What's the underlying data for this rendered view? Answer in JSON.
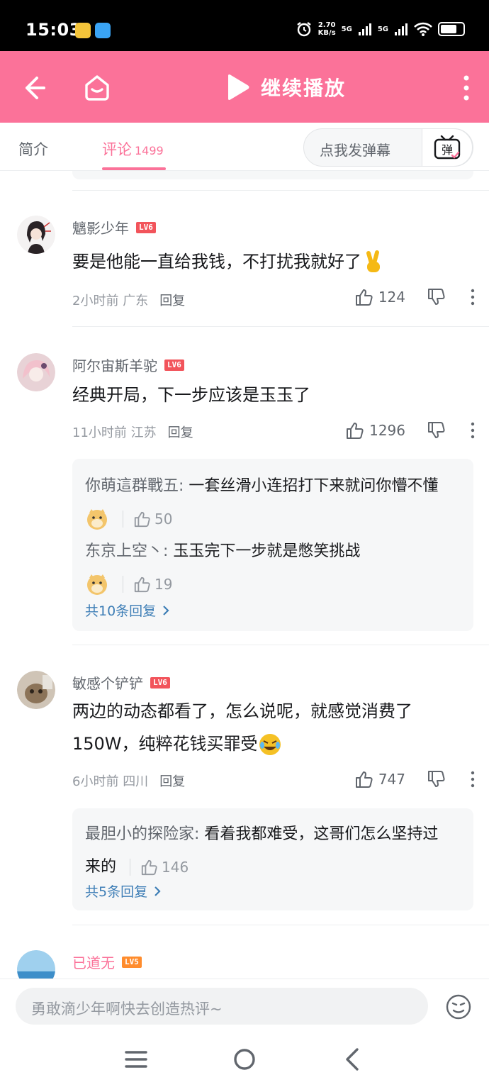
{
  "status_bar": {
    "time": "15:03",
    "speed_value": "2.70",
    "speed_unit": "KB/s",
    "net1": "5G",
    "net2": "5G"
  },
  "header": {
    "play_label": "继续播放",
    "icons": [
      "back-arrow-icon",
      "home-icon",
      "play-icon",
      "more-vertical-icon"
    ]
  },
  "tabs": {
    "intro": "简介",
    "comments": "评论",
    "comment_count": "1499",
    "danmaku_placeholder": "点我发弹幕",
    "danmaku_button": "弹"
  },
  "comments": [
    {
      "username": "魑影少年",
      "level": "LV6",
      "text": "要是他能一直给我钱，不打扰我就好了",
      "emoji": "victory-hand-emoji",
      "time": "2小时前",
      "location": "广东",
      "reply_label": "回复",
      "likes": "124"
    },
    {
      "username": "阿尔宙斯羊驼",
      "level": "LV6",
      "text": "经典开局，下一步应该是玉玉了",
      "time": "11小时前",
      "location": "江苏",
      "reply_label": "回复",
      "likes": "1296",
      "replies": [
        {
          "name": "你萌這群戰五:",
          "text": " 一套丝滑小连招打下来就问你懵不懂",
          "emoji": "doge-emoji",
          "likes": "50"
        },
        {
          "name": "东京上空丶:",
          "text": " 玉玉完下一步就是憋笑挑战",
          "emoji": "doge-emoji",
          "likes": "19"
        }
      ],
      "more_replies": "共10条回复"
    },
    {
      "username": "敏感个铲铲",
      "level": "LV6",
      "text": "两边的动态都看了，怎么说呢，就感觉消费了150W，纯粹花钱买罪受",
      "emoji": "laugh-cry-emoji",
      "time": "6小时前",
      "location": "四川",
      "reply_label": "回复",
      "likes": "747",
      "replies": [
        {
          "name": "最胆小的探险家:",
          "text": " 看着我都难受，这哥们怎么坚持过来的",
          "likes": "146"
        }
      ],
      "more_replies": "共5条回复"
    },
    {
      "username": "已道无",
      "level": "LV5"
    }
  ],
  "bottom": {
    "input_placeholder": "勇敢滴少年啊快去创造热评~"
  },
  "colors": {
    "accent": "#fb7299",
    "link": "#3e7eb6",
    "lv6": "#f2545b",
    "lv5": "#ff8c2d"
  }
}
